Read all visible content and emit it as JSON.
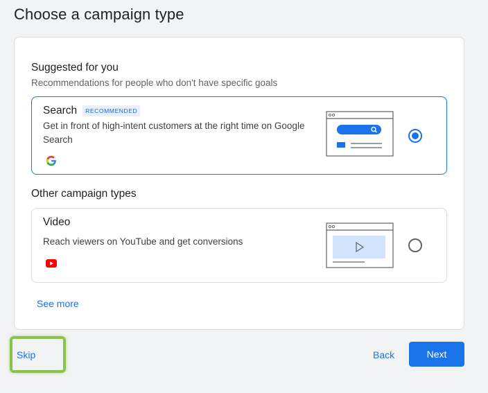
{
  "page": {
    "title": "Choose a campaign type"
  },
  "suggested": {
    "heading": "Suggested for you",
    "subheading": "Recommendations for people who don't have specific goals",
    "card": {
      "title": "Search",
      "badge": "RECOMMENDED",
      "description": "Get in front of high-intent customers at the right time on Google Search",
      "brand_icon": "google-icon",
      "illustration": "search-ad-illustration",
      "selected": true
    }
  },
  "other": {
    "heading": "Other campaign types",
    "card": {
      "title": "Video",
      "description": "Reach viewers on YouTube and get conversions",
      "brand_icon": "youtube-icon",
      "illustration": "video-ad-illustration",
      "selected": false
    }
  },
  "see_more_label": "See more",
  "footer": {
    "skip_label": "Skip",
    "back_label": "Back",
    "next_label": "Next"
  },
  "colors": {
    "accent": "#1a73e8",
    "highlight": "#8bc34a",
    "badge_bg": "#e8f0fe",
    "youtube_red": "#ff0000"
  }
}
